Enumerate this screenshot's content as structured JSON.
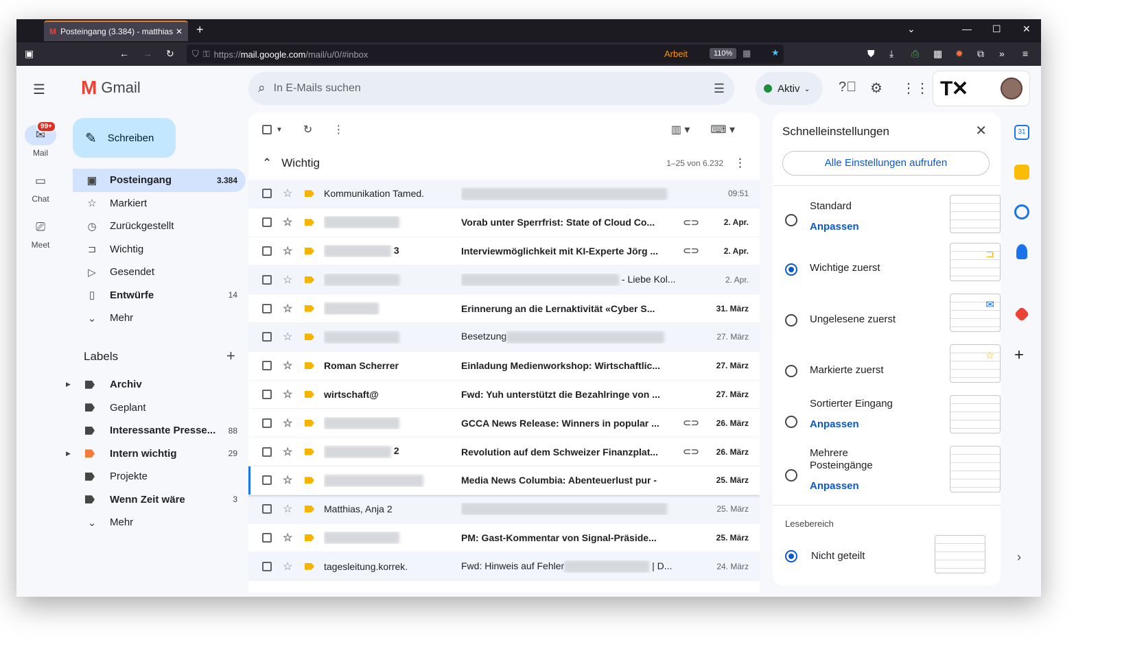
{
  "browser": {
    "tab_title": "Posteingang (3.384) - matthias",
    "url_scheme": "https://",
    "url_host": "mail.google.com",
    "url_path": "/mail/u/0/#inbox",
    "container": "Arbeit",
    "zoom": "110%"
  },
  "rail": {
    "mail": "Mail",
    "mail_badge": "99+",
    "chat": "Chat",
    "meet": "Meet"
  },
  "app": {
    "name": "Gmail"
  },
  "compose": "Schreiben",
  "search": {
    "placeholder": "In E-Mails suchen"
  },
  "status": "Aktiv",
  "nav": [
    {
      "label": "Posteingang",
      "count": "3.384",
      "icon": "inbox-icon"
    },
    {
      "label": "Markiert",
      "count": "",
      "icon": "star-icon"
    },
    {
      "label": "Zurückgestellt",
      "count": "",
      "icon": "clock-icon"
    },
    {
      "label": "Wichtig",
      "count": "",
      "icon": "important-icon"
    },
    {
      "label": "Gesendet",
      "count": "",
      "icon": "send-icon"
    },
    {
      "label": "Entwürfe",
      "count": "14",
      "icon": "draft-icon"
    },
    {
      "label": "Mehr",
      "count": "",
      "icon": "chevron-down-icon"
    }
  ],
  "labels": {
    "title": "Labels",
    "items": [
      {
        "label": "Archiv",
        "count": ""
      },
      {
        "label": "Geplant",
        "count": ""
      },
      {
        "label": "Interessante Presse...",
        "count": "88"
      },
      {
        "label": "Intern wichtig",
        "count": "29"
      },
      {
        "label": "Projekte",
        "count": ""
      },
      {
        "label": "Wenn Zeit wäre",
        "count": "3"
      },
      {
        "label": "Mehr",
        "count": ""
      }
    ]
  },
  "list": {
    "section": "Wichtig",
    "range": "1–25 von 6.232",
    "rows": [
      {
        "sender": "Kommunikation Tamed.",
        "subject": "",
        "date": "09:51"
      },
      {
        "sender": "",
        "subject": "Vorab unter Sperrfrist: State of Cloud Co...",
        "date": "2. Apr."
      },
      {
        "sender": "3",
        "subject": "Interviewmöglichkeit mit KI-Experte Jörg ...",
        "date": "2. Apr."
      },
      {
        "sender": "",
        "subject": "- Liebe Kol...",
        "date": "2. Apr."
      },
      {
        "sender": "",
        "subject": "Erinnerung an die Lernaktivität «Cyber S...",
        "date": "31. März"
      },
      {
        "sender": "",
        "subject": "Besetzung",
        "date": "27. März"
      },
      {
        "sender": "Roman Scherrer",
        "subject": "Einladung Medienworkshop: Wirtschaftlic...",
        "date": "27. März"
      },
      {
        "sender": "wirtschaft@",
        "subject": "Fwd: Yuh unterstützt die Bezahlringe von ...",
        "date": "27. März"
      },
      {
        "sender": "",
        "subject": "GCCA News Release: Winners in popular ...",
        "date": "26. März"
      },
      {
        "sender": "2",
        "subject": "Revolution auf dem Schweizer Finanzplat...",
        "date": "26. März"
      },
      {
        "sender": "",
        "subject": "Media News Columbia: Abenteuerlust pur -",
        "date": "25. März"
      },
      {
        "sender": "Matthias, Anja 2",
        "subject": "",
        "date": "25. März"
      },
      {
        "sender": "",
        "subject": "PM: Gast-Kommentar von Signal-Präside...",
        "date": "25. März"
      },
      {
        "sender": "tagesleitung.korrek.",
        "subject": "Fwd: Hinweis auf Fehler",
        "subject_tail": "| D...",
        "date": "24. März"
      }
    ]
  },
  "quick": {
    "title": "Schnelleinstellungen",
    "all": "Alle Einstellungen aufrufen",
    "customize": "Anpassen",
    "types": [
      "Standard",
      "Wichtige zuerst",
      "Ungelesene zuerst",
      "Markierte zuerst",
      "Sortierter Eingang",
      "Mehrere",
      "Posteingänge"
    ],
    "reading": "Lesebereich",
    "reading_opt": "Nicht geteilt"
  }
}
